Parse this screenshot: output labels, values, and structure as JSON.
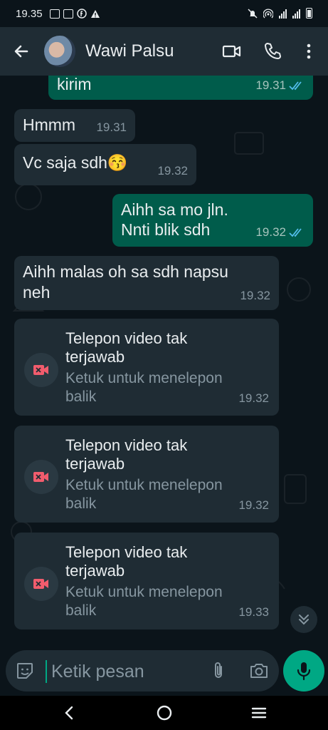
{
  "status_bar": {
    "time": "19.35"
  },
  "header": {
    "contact_name": "Wawi Palsu"
  },
  "messages": [
    {
      "direction": "out",
      "text": "kirim",
      "time": "19.31",
      "read": true
    },
    {
      "direction": "in",
      "text": "Hmmm",
      "time": "19.31"
    },
    {
      "direction": "in",
      "text": "Vc saja sdh😚",
      "time": "19.32"
    },
    {
      "direction": "out",
      "lines": [
        "Aihh sa mo jln.",
        "Nnti blik sdh"
      ],
      "time": "19.32",
      "read": true
    },
    {
      "direction": "in",
      "lines": [
        "Aihh malas oh sa sdh napsu",
        "neh"
      ],
      "time": "19.32"
    }
  ],
  "missed_calls": [
    {
      "title": "Telepon video tak terjawab",
      "subtitle": "Ketuk untuk menelepon balik",
      "time": "19.32"
    },
    {
      "title": "Telepon video tak terjawab",
      "subtitle": "Ketuk untuk menelepon balik",
      "time": "19.32"
    },
    {
      "title": "Telepon video tak terjawab",
      "subtitle": "Ketuk untuk menelepon balik",
      "time": "19.33"
    }
  ],
  "composer": {
    "placeholder": "Ketik pesan"
  },
  "colors": {
    "app_bar": "#1f2c34",
    "outgoing_bubble": "#005c4b",
    "incoming_bubble": "#1f2c34",
    "accent_green": "#00a884",
    "missed_call_red": "#f15c6d",
    "read_ticks": "#53bdeb"
  }
}
